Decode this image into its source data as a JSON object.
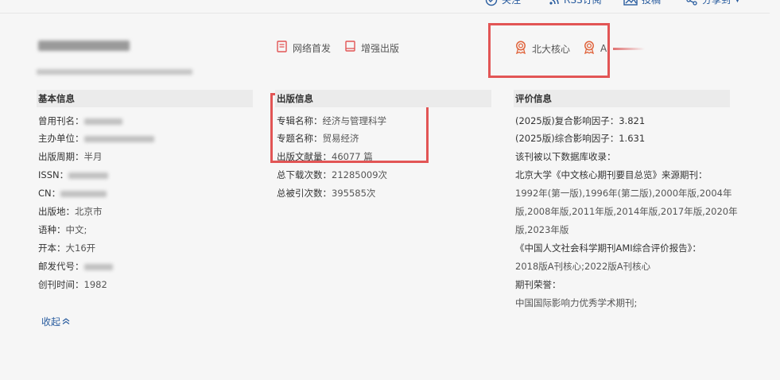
{
  "topbar": {
    "follow": "关注",
    "rss": "RSS订阅",
    "submit": "投稿",
    "share": "分享到"
  },
  "pub_tags": {
    "online_first": "网络首发",
    "enhanced": "增强出版"
  },
  "badges": {
    "pku_core": "北大核心",
    "second": "A"
  },
  "basic_info": {
    "title": "基本信息",
    "former_name_label": "曾用刊名：",
    "sponsor_label": "主办单位：",
    "period_label": "出版周期：",
    "period_value": "半月",
    "issn_label": "ISSN：",
    "cn_label": "CN：",
    "place_label": "出版地：",
    "place_value": "北京市",
    "language_label": "语种：",
    "language_value": "中文;",
    "format_label": "开本：",
    "format_value": "大16开",
    "postal_label": "邮发代号：",
    "founded_label": "创刊时间：",
    "founded_value": "1982"
  },
  "publication_info": {
    "title": "出版信息",
    "series_label": "专辑名称：",
    "series_value": "经济与管理科学",
    "topic_label": "专题名称：",
    "topic_value": "贸易经济",
    "count_label": "出版文献量：",
    "count_value": "46077 篇",
    "downloads_label": "总下载次数：",
    "downloads_value": "21285009次",
    "citations_label": "总被引次数：",
    "citations_value": "395585次"
  },
  "evaluation_info": {
    "title": "评价信息",
    "lines": [
      "(2025版)复合影响因子：3.821",
      "(2025版)综合影响因子：1.631",
      "该刊被以下数据库收录：",
      "北京大学《中文核心期刊要目总览》来源期刊：",
      "1992年(第一版),1996年(第二版),2000年版,2004年",
      "版,2008年版,2011年版,2014年版,2017年版,2020年",
      "版,2023年版",
      "《中国人文社会科学期刊AMI综合评价报告》：",
      "2018版A刊核心;2022版A刊核心",
      "期刊荣誉：",
      "中国国际影响力优秀学术期刊;"
    ]
  },
  "collapse_label": "收起",
  "colors": {
    "link": "#2a5d9f",
    "highlight_box": "#e25555",
    "section_bg": "#ebebeb",
    "badge_icon": "#e0643c"
  }
}
